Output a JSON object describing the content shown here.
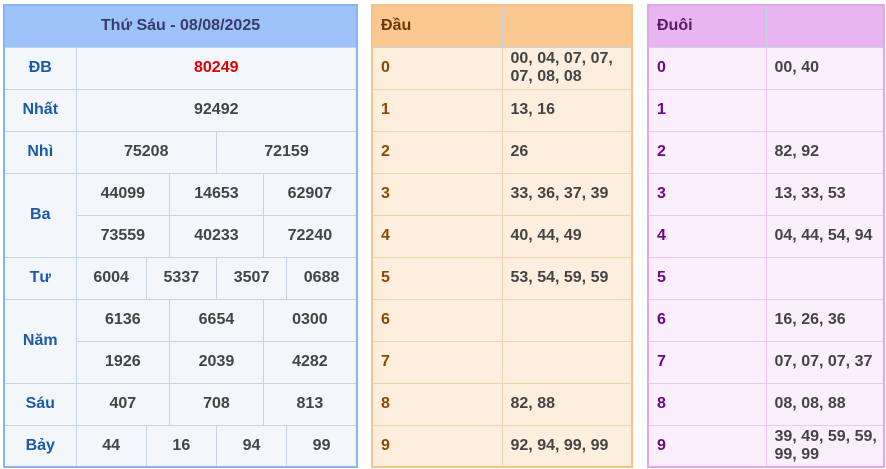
{
  "results": {
    "title": "Thứ Sáu - 08/08/2025",
    "prizes": [
      {
        "label": "ĐB",
        "numbers": [
          "80249"
        ]
      },
      {
        "label": "Nhất",
        "numbers": [
          "92492"
        ]
      },
      {
        "label": "Nhì",
        "numbers": [
          "75208",
          "72159"
        ]
      },
      {
        "label": "Ba",
        "numbers": [
          "44099",
          "14653",
          "62907",
          "73559",
          "40233",
          "72240"
        ]
      },
      {
        "label": "Tư",
        "numbers": [
          "6004",
          "5337",
          "3507",
          "0688"
        ]
      },
      {
        "label": "Năm",
        "numbers": [
          "6136",
          "6654",
          "0300",
          "1926",
          "2039",
          "4282"
        ]
      },
      {
        "label": "Sáu",
        "numbers": [
          "407",
          "708",
          "813"
        ]
      },
      {
        "label": "Bảy",
        "numbers": [
          "44",
          "16",
          "94",
          "99"
        ]
      }
    ]
  },
  "dau": {
    "title": "Đầu",
    "rows": [
      {
        "key": "0",
        "values": "00, 04, 07, 07, 07, 08, 08"
      },
      {
        "key": "1",
        "values": "13, 16"
      },
      {
        "key": "2",
        "values": "26"
      },
      {
        "key": "3",
        "values": "33, 36, 37, 39"
      },
      {
        "key": "4",
        "values": "40, 44, 49"
      },
      {
        "key": "5",
        "values": "53, 54, 59, 59"
      },
      {
        "key": "6",
        "values": ""
      },
      {
        "key": "7",
        "values": ""
      },
      {
        "key": "8",
        "values": "82, 88"
      },
      {
        "key": "9",
        "values": "92, 94, 99, 99"
      }
    ]
  },
  "duoi": {
    "title": "Đuôi",
    "rows": [
      {
        "key": "0",
        "values": "00, 40"
      },
      {
        "key": "1",
        "values": ""
      },
      {
        "key": "2",
        "values": "82, 92"
      },
      {
        "key": "3",
        "values": "13, 33, 53"
      },
      {
        "key": "4",
        "values": "04, 44, 54, 94"
      },
      {
        "key": "5",
        "values": ""
      },
      {
        "key": "6",
        "values": "16, 26, 36"
      },
      {
        "key": "7",
        "values": "07, 07, 07, 37"
      },
      {
        "key": "8",
        "values": "08, 08, 88"
      },
      {
        "key": "9",
        "values": "39, 49, 59, 59, 99, 99"
      }
    ]
  },
  "colors": {
    "special_prize": "#e00000",
    "results_header": "#9ec2fa",
    "dau_header": "#fcc892",
    "duoi_header": "#e8b5f1"
  }
}
